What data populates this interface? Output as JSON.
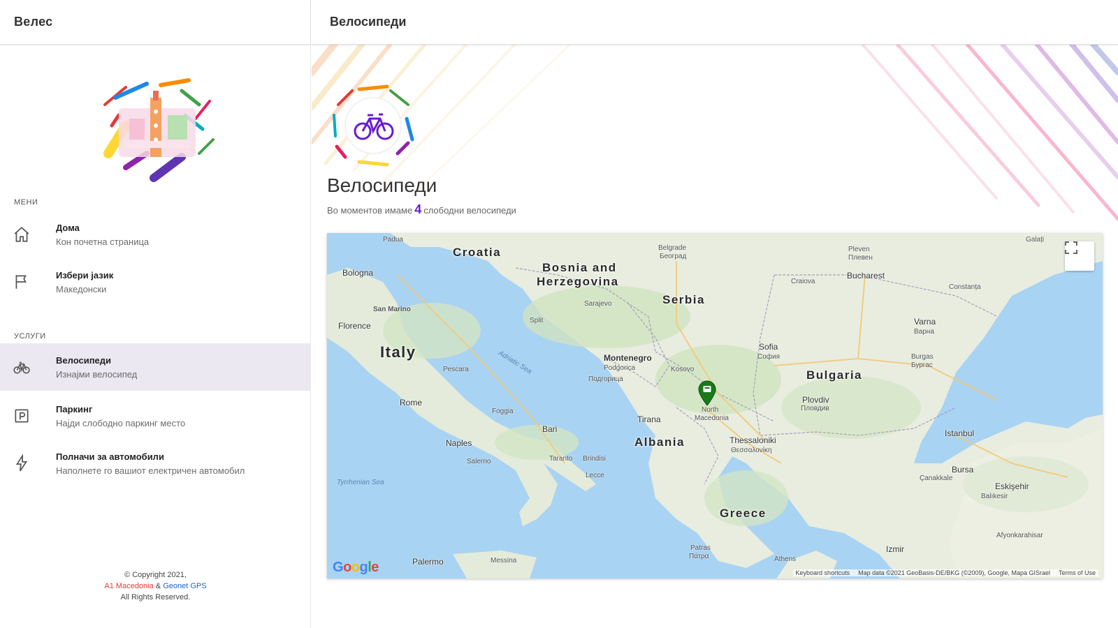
{
  "sidebar": {
    "app_title": "Велес",
    "menu_label": "МЕНИ",
    "services_label": "УСЛУГИ",
    "menu_items": [
      {
        "title": "Дома",
        "subtitle": "Кон почетна страница",
        "icon": "home-icon"
      },
      {
        "title": "Избери јазик",
        "subtitle": "Македонски",
        "icon": "flag-icon"
      }
    ],
    "service_items": [
      {
        "title": "Велосипеди",
        "subtitle": "Изнајми велосипед",
        "icon": "bike-icon"
      },
      {
        "title": "Паркинг",
        "subtitle": "Најди слободно паркинг место",
        "icon": "parking-icon"
      },
      {
        "title": "Полначи за автомобили",
        "subtitle": "Наполнете го вашиот електричен автомобил",
        "icon": "lightning-icon"
      }
    ],
    "copyright": {
      "line1": "© Copyright 2021,",
      "link1": "A1 Macedonia",
      "amp": "&",
      "link2": "Geonet GPS",
      "line3": "All Rights Reserved."
    }
  },
  "main": {
    "header_title": "Велосипеди",
    "page_title": "Велосипеди",
    "subtitle_before": "Во моментов имаме",
    "available_count": "4",
    "subtitle_after": "слободни велосипеди"
  },
  "map": {
    "countries": [
      "Croatia",
      "Bosnia and",
      "Herzegovina",
      "Serbia",
      "Italy",
      "Montenegro",
      "Kosovo",
      "Bulgaria",
      "Albania",
      "Greece",
      "North",
      "Macedonia"
    ],
    "cities": [
      "Bologna",
      "San Marino",
      "Florence",
      "Rome",
      "Naples",
      "Bari",
      "Sarajevo",
      "Belgrade",
      "Београд",
      "Sofia",
      "София",
      "Bucharest",
      "Varna",
      "Варна",
      "Plovdiv",
      "Пловдив",
      "Thessaloniki",
      "Θεσσαλονίκη",
      "Tirana",
      "Istanbul",
      "Bursa",
      "Eskişehir",
      "Izmir",
      "Palermo",
      "Podgorica",
      "Подгорица",
      "Pescara",
      "Foggia",
      "Taranto",
      "Brindisi",
      "Salerno",
      "Lecce",
      "Craiova",
      "Constanța",
      "Burgas",
      "Бургас",
      "Pleven",
      "Плевен",
      "Split",
      "Padua",
      "Galați",
      "Balıkesir",
      "Çanakkale",
      "Messina",
      "Afyonkarahisar",
      "Patras",
      "Πάτρα",
      "Athens"
    ],
    "seas": [
      "Adriatic Sea",
      "Tyrrhenian Sea"
    ],
    "google_label": "Google",
    "keyboard_shortcuts": "Keyboard shortcuts",
    "map_data": "Map data ©2021 GeoBasis-DE/BKG (©2009), Google, Mapa GISrael",
    "terms": "Terms of Use",
    "marker_color": "#1b7a1b",
    "accent_color": "#6a1bd1"
  }
}
